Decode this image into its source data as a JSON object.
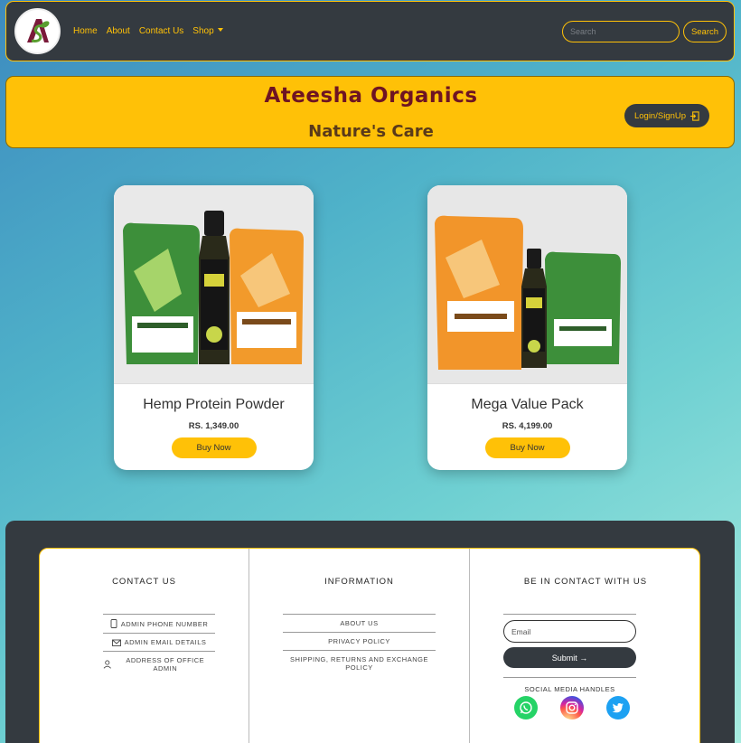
{
  "nav": {
    "links": [
      "Home",
      "About",
      "Contact Us",
      "Shop"
    ],
    "search_placeholder": "Search",
    "search_button": "Search",
    "logo_text": "AS"
  },
  "hero": {
    "title": "Ateesha Organics",
    "subtitle": "Nature's Care",
    "login_label": "Login/SignUp"
  },
  "products": [
    {
      "name": "Hemp Protein Powder",
      "price": "RS. 1,349.00",
      "button": "Buy Now"
    },
    {
      "name": "Mega Value Pack",
      "price": "RS. 4,199.00",
      "button": "Buy Now"
    }
  ],
  "footer": {
    "contact": {
      "heading": "CONTACT US",
      "items": [
        "ADMIN PHONE NUMBER",
        "ADMIN EMAIL DETAILS",
        "ADDRESS OF OFFICE ADMIN"
      ]
    },
    "information": {
      "heading": "INFORMATION",
      "items": [
        "ABOUT US",
        "PRIVACY POLICY",
        "SHIPPING, RETURNS AND EXCHANGE POLICY"
      ]
    },
    "connect": {
      "heading": "BE IN CONTACT WITH US",
      "email_placeholder": "Email",
      "submit_label": "Submit",
      "social_label": "SOCIAL MEDIA HANDLES",
      "socials": [
        "whatsapp-icon",
        "instagram-icon",
        "twitter-icon"
      ]
    }
  },
  "colors": {
    "accent": "#ffc107",
    "dark": "#343a40",
    "brand": "#6e1423"
  }
}
